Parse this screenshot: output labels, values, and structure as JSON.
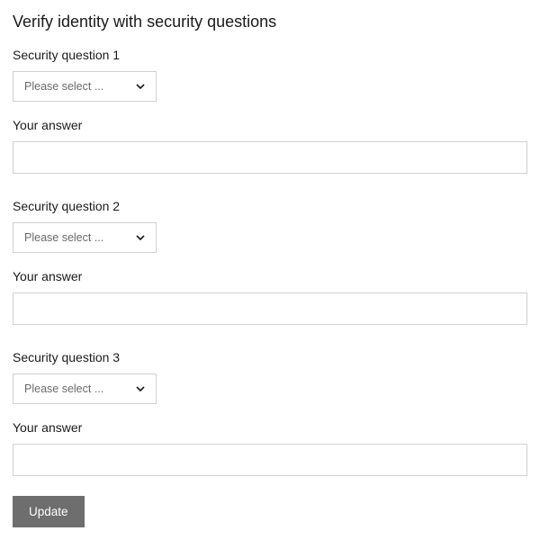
{
  "title": "Verify identity with security questions",
  "questions": [
    {
      "label": "Security question 1",
      "select_placeholder": "Please select ...",
      "answer_label": "Your answer",
      "answer_value": ""
    },
    {
      "label": "Security question 2",
      "select_placeholder": "Please select ...",
      "answer_label": "Your answer",
      "answer_value": ""
    },
    {
      "label": "Security question 3",
      "select_placeholder": "Please select ...",
      "answer_label": "Your answer",
      "answer_value": ""
    }
  ],
  "update_button_label": "Update"
}
